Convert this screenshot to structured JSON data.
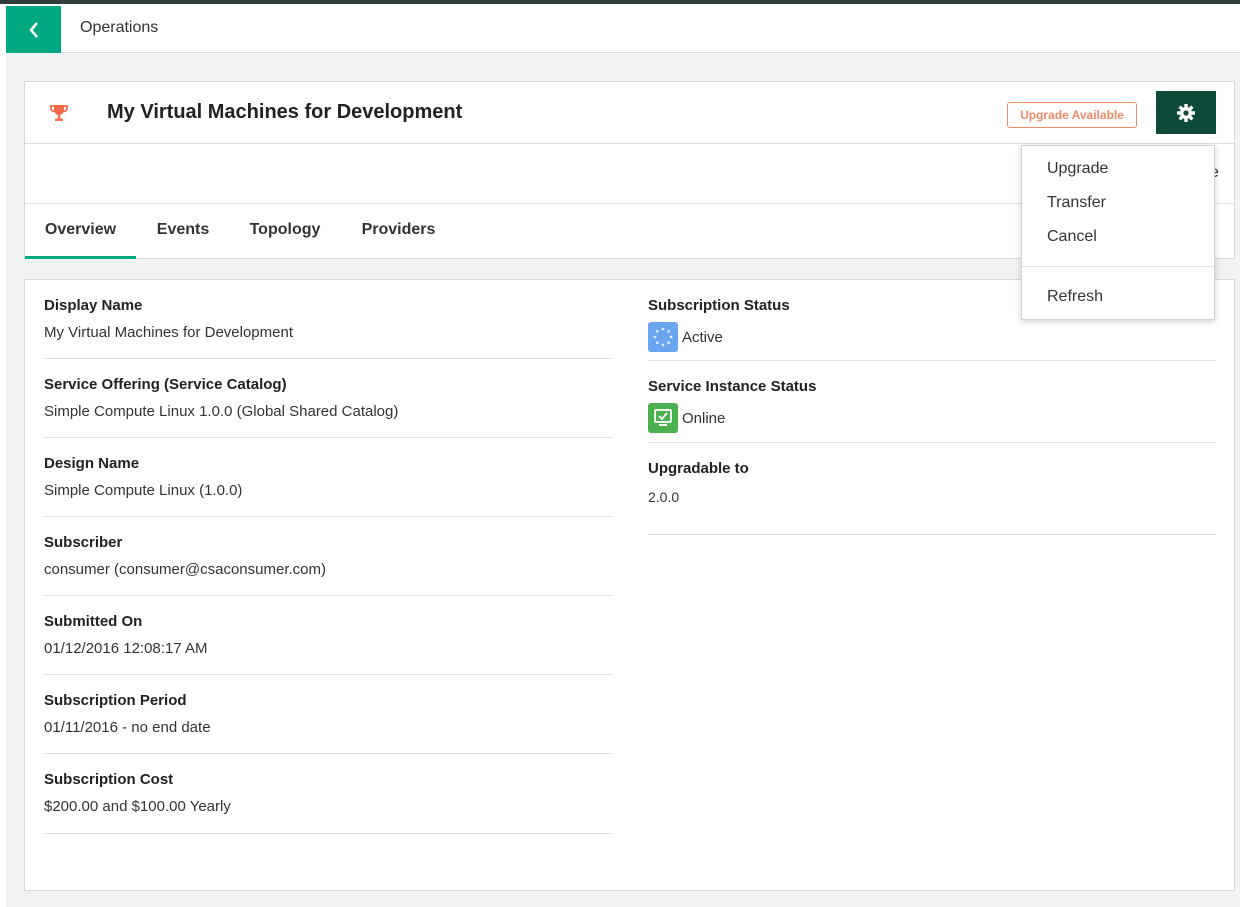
{
  "topbar": {
    "breadcrumb": "Operations"
  },
  "header": {
    "title": "My Virtual Machines for Development",
    "badge": "Upgrade Available",
    "partial_right_text": "e"
  },
  "tabs": [
    {
      "label": "Overview",
      "active": true
    },
    {
      "label": "Events",
      "active": false
    },
    {
      "label": "Topology",
      "active": false
    },
    {
      "label": "Providers",
      "active": false
    }
  ],
  "left_fields": [
    {
      "label": "Display Name",
      "value": "My Virtual Machines for Development"
    },
    {
      "label": "Service Offering (Service Catalog)",
      "value": "Simple Compute Linux 1.0.0 (Global Shared Catalog)"
    },
    {
      "label": "Design Name",
      "value": "Simple Compute Linux (1.0.0)"
    },
    {
      "label": "Subscriber",
      "value": "consumer (consumer@csaconsumer.com)"
    },
    {
      "label": "Submitted On",
      "value": "01/12/2016 12:08:17 AM"
    },
    {
      "label": "Subscription Period",
      "value": "01/11/2016 - no end date"
    },
    {
      "label": "Subscription Cost",
      "value": "$200.00 and $100.00 Yearly"
    }
  ],
  "right_fields": {
    "subscription_status": {
      "label": "Subscription Status",
      "value": "Active",
      "icon": "active-status-icon"
    },
    "service_instance_status": {
      "label": "Service Instance Status",
      "value": "Online",
      "icon": "online-monitor-icon"
    },
    "upgradable_to": {
      "label": "Upgradable to",
      "value": "2.0.0"
    }
  },
  "menu": {
    "items": [
      "Upgrade",
      "Transfer",
      "Cancel",
      "Refresh"
    ]
  },
  "colors": {
    "accent_green": "#01a982",
    "gear_button": "#0d4a3a",
    "badge_orange": "#f08a6c",
    "trophy": "#f26b4d",
    "active_blue": "#6aa6f0",
    "online_green": "#4caf50"
  }
}
